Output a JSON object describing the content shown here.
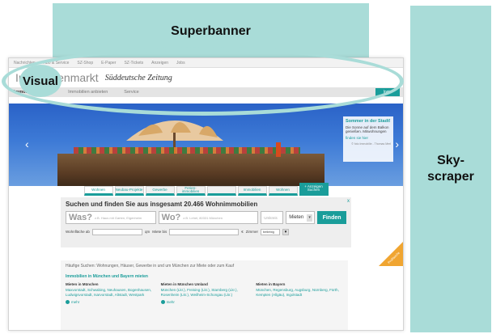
{
  "ad_slots": {
    "superbanner": "Superbanner",
    "skyscraper": "Sky-\nscraper",
    "visual": "Visual"
  },
  "topnav": {
    "items": [
      "Nachrichten",
      "Abo & Service",
      "SZ-Shop",
      "E-Paper",
      "SZ-Tickets",
      "Anzeigen",
      "Jobs"
    ]
  },
  "brand": {
    "name": "Immobilienmarkt",
    "paper": "Süddeutsche Zeitung"
  },
  "mainnav": {
    "items": [
      "Immobilien finden",
      "Immobilien anbieten",
      "Service"
    ],
    "login": "login"
  },
  "hero": {
    "box_title": "Sommer in der Stadt!",
    "box_text": "Die Sonne auf dem Balkon genießen. Mitwohnungen",
    "box_more": "finden sie hier",
    "box_credit": "© foto Immobilie - Thomas Merl",
    "prev": "‹",
    "next": "›"
  },
  "category_tabs": [
    "Wohnen",
    "Neubau-Projekte",
    "Gewerbe",
    "Ferien-immobilien",
    "",
    "Immobilien",
    "Wohnen"
  ],
  "category_cta": "+ Anzeigen Suchen",
  "search": {
    "headline": "Suchen und finden Sie aus insgesamt 20.466 Wohnimmobilien",
    "was_label": "Was?",
    "was_placeholder": "z.B. Haus mit Garten, Eigenheim",
    "wo_label": "Wo?",
    "wo_placeholder": "z.B. Lehel, 80331 München",
    "umkreis": "Umkreis",
    "mode": "Mieten",
    "find_button": "Finden",
    "wohnflaeche_label": "Wohnfläche ab",
    "wohnflaeche_unit": "qm",
    "miete_label": "Miete bis",
    "miete_unit": "€",
    "zimmer_label": "Zimmer",
    "zimmer_value": "beliebig",
    "close": "x"
  },
  "corner_tag": "Profisuche",
  "lower": {
    "intro": "Häufige Suchen: Wohnungen, Häuser, Gewerbe in und um München zur Miete oder zum Kauf",
    "section_title": "Immobilien in München und Bayern mieten",
    "columns": [
      {
        "title": "Mieten in München",
        "links": "Maxvorstadt, Schwabing, Neuhausen, Bogenhausen, Ludwigsvorstadt, Isarvorstadt, Altstadt, Westpark",
        "more": "mehr"
      },
      {
        "title": "Mieten in München Umland",
        "links": "München (Lkr.), Freising (Lkr.), Starnberg (Lkr.), Rosenheim (Lkr.), Weilheim-Schongau (Lkr.)",
        "more": "mehr"
      },
      {
        "title": "Mieten in Bayern",
        "links": "München, Regensburg, Augsburg, Nürnberg, Fürth, Kempten (Allgäu), Ingolstadt",
        "more": ""
      }
    ]
  }
}
